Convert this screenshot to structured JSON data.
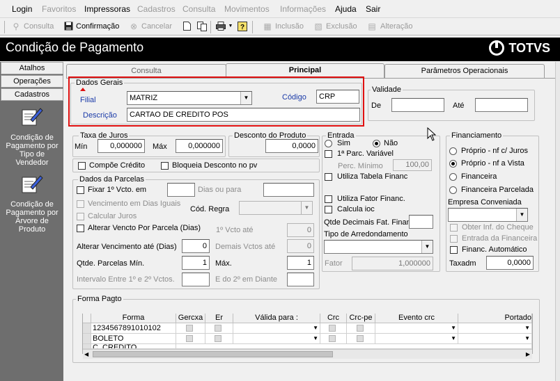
{
  "menu": [
    "Login",
    "Favoritos",
    "Impressoras",
    "Cadastros",
    "Consulta",
    "Movimentos",
    "Informações",
    "Ajuda",
    "Sair"
  ],
  "toolbar": {
    "consulta": "Consulta",
    "confirmacao": "Confirmação",
    "cancelar": "Cancelar",
    "inclusao": "Inclusão",
    "exclusao": "Exclusão",
    "alteracao": "Alteração"
  },
  "window_title": "Condição de Pagamento",
  "brand": "TOTVS",
  "left": {
    "atalhos": "Atalhos",
    "operacoes": "Operações",
    "cadastros": "Cadastros",
    "item1": "Condição de Pagamento por Tipo de Vendedor",
    "item2": "Condição de Pagamento por Árvore de Produto"
  },
  "tabs": [
    "Consulta",
    "Principal",
    "Parâmetros Operacionais"
  ],
  "dados_gerais": {
    "label": "Dados Gerais",
    "filial_label": "Filial",
    "filial": "MATRIZ",
    "codigo_label": "Código",
    "codigo": "CRP",
    "descricao_label": "Descrição",
    "descricao": "CARTAO DE CREDITO POS"
  },
  "validade": {
    "label": "Validade",
    "de_label": "De",
    "de": "",
    "ate_label": "Até",
    "ate": ""
  },
  "taxa": {
    "label": "Taxa de Juros",
    "min_label": "Mín",
    "min": "0,000000",
    "max_label": "Máx",
    "max": "0,000000"
  },
  "desconto": {
    "label": "Desconto do Produto",
    "value": "0,0000"
  },
  "compoe_credito": "Compõe Crédito",
  "bloqueia_desconto": "Bloqueia Desconto no pv",
  "parcelas": {
    "label": "Dados da Parcelas",
    "fixar": "Fixar 1º Vcto. em",
    "fixar_val": "",
    "dias_label": "Dias ou para",
    "dias_val": "",
    "venc_iguais": "Vencimento em Dias Iguais",
    "cod_regra": "Cód. Regra",
    "calcular_juros": "Calcular Juros",
    "alterar_vencto": "Alterar Vencto Por Parcela (Dias)",
    "primeiro_vcto": "1º Vcto até",
    "primeiro_vcto_val": "0",
    "alterar_ate": "Alterar Vencimento até (Dias)",
    "alterar_ate_val": "0",
    "demais": "Demais Vctos até",
    "demais_val": "0",
    "qtde_min": "Qtde. Parcelas Mín.",
    "qtde_min_val": "1",
    "max": "Máx.",
    "max_val": "1",
    "intervalo": "Intervalo Entre 1º e 2º Vctos.",
    "intervalo_val": "",
    "e_do": "E do 2º em Diante",
    "e_do_val": ""
  },
  "entrada": {
    "label": "Entrada",
    "sim": "Sim",
    "nao": "Não",
    "primeira_parc": "1ª Parc. Variável",
    "perc_minimo": "Perc. Mínimo",
    "perc_val": "100,00",
    "tabela_financ": "Utiliza Tabela Financ",
    "fator_financ": "Utiliza Fator Financ.",
    "calcula_ioc": "Calcula ioc",
    "qtde_dec": "Qtde Decimais Fat. Finan",
    "qtde_dec_val": "",
    "tipo_arred": "Tipo de Arredondamento",
    "fator": "Fator",
    "fator_val": "1,000000"
  },
  "financiamento": {
    "label": "Financiamento",
    "opt1": "Próprio - nf c/ Juros",
    "opt2": "Próprio - nf a Vista",
    "opt3": "Financeira",
    "opt4": "Financeira Parcelada",
    "empresa": "Empresa Conveniada",
    "obter": "Obter Inf. do Cheque",
    "entrada_fin": "Entrada da Financeira",
    "automatico": "Financ. Automático",
    "taxadm": "Taxadm",
    "taxadm_val": "0,0000"
  },
  "forma_pagto": {
    "label": "Forma Pagto",
    "columns": [
      "Forma",
      "Gercxa",
      "Er",
      "Válida para :",
      "Crc",
      "Crc-pe",
      "Evento crc",
      "Portado"
    ],
    "rows": [
      "1234567891010102",
      "BOLETO",
      "C. CREDITO"
    ]
  }
}
